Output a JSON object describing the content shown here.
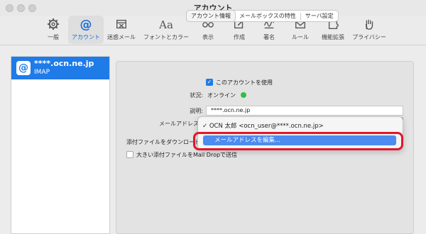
{
  "window": {
    "title": "アカウント"
  },
  "toolbar": {
    "items": [
      {
        "label": "一般",
        "icon": "gear-icon"
      },
      {
        "label": "アカウント",
        "icon": "at-icon",
        "active": true
      },
      {
        "label": "迷惑メール",
        "icon": "junk-icon"
      },
      {
        "label": "フォントとカラー",
        "icon": "font-icon"
      },
      {
        "label": "表示",
        "icon": "glasses-icon"
      },
      {
        "label": "作成",
        "icon": "compose-icon"
      },
      {
        "label": "署名",
        "icon": "signature-icon"
      },
      {
        "label": "ルール",
        "icon": "rules-icon"
      },
      {
        "label": "機能拡張",
        "icon": "puzzle-icon"
      },
      {
        "label": "プライバシー",
        "icon": "hand-icon"
      }
    ],
    "font_glyph": "Aa",
    "at_glyph": "@"
  },
  "sidebar": {
    "account": {
      "name": "****.ocn.ne.jp",
      "type": "IMAP",
      "icon_glyph": "@"
    }
  },
  "tabs": [
    "アカウント情報",
    "メールボックスの特性",
    "サーバ設定"
  ],
  "form": {
    "enable_label": "このアカウントを使用",
    "status_label": "状況:",
    "status_value": "オンライン",
    "description_label": "説明:",
    "description_value": "****.ocn.ne.jp",
    "email_label": "メールアドレス",
    "download_label": "添付ファイルをダウンロード",
    "large_attach_label": "大きい添付ファイルをMail Dropで送信"
  },
  "dropdown": {
    "current": "✓ OCN 太郎 <ocn_user@****.ocn.ne.jp>",
    "edit": "メールアドレスを編集..."
  },
  "colors": {
    "accent": "#1f7be8",
    "highlight": "#e3162a",
    "status_online": "#2fbf4a"
  }
}
